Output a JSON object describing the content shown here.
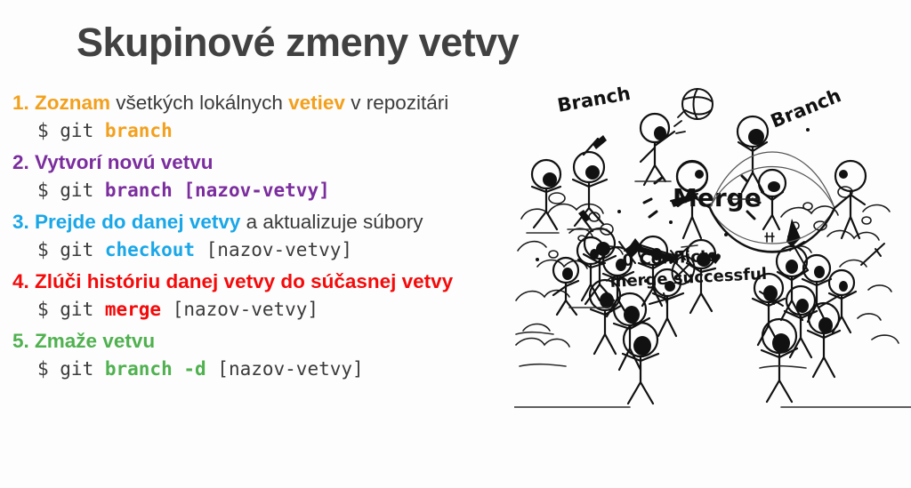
{
  "slide": {
    "title": "Skupinové zmeny vetvy",
    "background_color": "#fdfdfd",
    "title_color": "#414141"
  },
  "palette": {
    "orange": "#f3a01c",
    "purple": "#7b2d9e",
    "blue": "#1aa7e8",
    "red": "#f50a0a",
    "green": "#4fb14f",
    "dark": "#3b3b3b"
  },
  "steps": [
    {
      "number": "1.",
      "accent": "#f3a01c",
      "head_parts": [
        {
          "text": "Zoznam",
          "style": "key"
        },
        {
          "text": " všetkých lokálnych ",
          "style": "rest"
        },
        {
          "text": "vetiev",
          "style": "key"
        },
        {
          "text": " v repozitári",
          "style": "rest"
        }
      ],
      "cmd_parts": [
        {
          "text": "$ git ",
          "style": "plain"
        },
        {
          "text": "branch",
          "style": "cmd"
        }
      ]
    },
    {
      "number": "2.",
      "accent": "#7b2d9e",
      "head_parts": [
        {
          "text": "Vytvorí novú vetvu",
          "style": "key"
        }
      ],
      "cmd_parts": [
        {
          "text": "$ git ",
          "style": "plain"
        },
        {
          "text": "branch ",
          "style": "cmd"
        },
        {
          "text": "[nazov-vetvy]",
          "style": "cmd"
        }
      ]
    },
    {
      "number": "3.",
      "accent": "#1aa7e8",
      "head_parts": [
        {
          "text": "Prejde do danej vetvy",
          "style": "key"
        },
        {
          "text": " a aktualizuje súbory",
          "style": "rest"
        }
      ],
      "cmd_parts": [
        {
          "text": "$ git ",
          "style": "plain"
        },
        {
          "text": "checkout ",
          "style": "cmd"
        },
        {
          "text": "[nazov-vetvy]",
          "style": "plain"
        }
      ]
    },
    {
      "number": "4.",
      "accent": "#f50a0a",
      "head_parts": [
        {
          "text": "Zlúči históriu danej vetvy do súčasnej vetvy",
          "style": "key"
        }
      ],
      "cmd_parts": [
        {
          "text": "$ git ",
          "style": "plain"
        },
        {
          "text": "merge ",
          "style": "cmd"
        },
        {
          "text": "[nazov-vetvy]",
          "style": "plain"
        }
      ]
    },
    {
      "number": "5.",
      "accent": "#4fb14f",
      "head_parts": [
        {
          "text": "Zmaže vetvu",
          "style": "key"
        }
      ],
      "cmd_parts": [
        {
          "text": "$ git ",
          "style": "plain"
        },
        {
          "text": "branch -d ",
          "style": "cmd"
        },
        {
          "text": "[nazov-vetvy]",
          "style": "plain"
        }
      ]
    }
  ],
  "illustration": {
    "label_branch_left": "Branch",
    "label_branch_right": "Branch",
    "label_merge": "Merge",
    "caption_line1": "0 Conflicts",
    "caption_heart": "♥",
    "caption_line2": "merge successful"
  }
}
